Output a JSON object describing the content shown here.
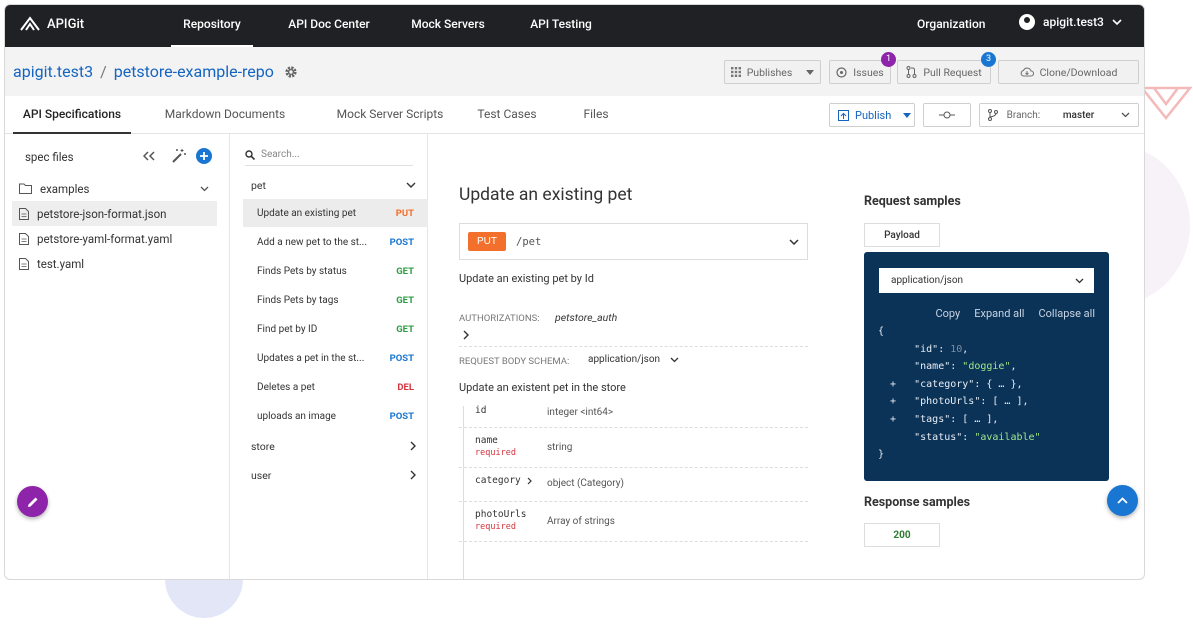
{
  "brand": {
    "name": "APIGit"
  },
  "nav": {
    "tabs": [
      "Repository",
      "API Doc Center",
      "Mock Servers",
      "API Testing"
    ],
    "organization": "Organization",
    "username": "apigit.test3"
  },
  "repo": {
    "owner": "apigit.test3",
    "separator": "/",
    "name": "petstore-example-repo",
    "publishes_label": "Publishes",
    "issues_label": "Issues",
    "issues_count": "1",
    "pull_request_label": "Pull Request",
    "pull_request_count": "3",
    "clone_label": "Clone/Download"
  },
  "subtabs": [
    "API Specifications",
    "Markdown Documents",
    "Mock Server Scripts",
    "Test Cases",
    "Files"
  ],
  "toolbar": {
    "publish_label": "Publish",
    "branch_label": "Branch:",
    "branch_value": "master"
  },
  "sidebar": {
    "title": "spec files",
    "folder": "examples",
    "files": [
      "petstore-json-format.json",
      "petstore-yaml-format.yaml",
      "test.yaml"
    ]
  },
  "operations": {
    "search_placeholder": "Search...",
    "groups": [
      "pet",
      "store",
      "user"
    ],
    "items": [
      {
        "label": "Update an existing pet",
        "method": "PUT"
      },
      {
        "label": "Add a new pet to the st...",
        "method": "POST"
      },
      {
        "label": "Finds Pets by status",
        "method": "GET"
      },
      {
        "label": "Finds Pets by tags",
        "method": "GET"
      },
      {
        "label": "Find pet by ID",
        "method": "GET"
      },
      {
        "label": "Updates a pet in the st...",
        "method": "POST"
      },
      {
        "label": "Deletes a pet",
        "method": "DEL"
      },
      {
        "label": "uploads an image",
        "method": "POST"
      }
    ]
  },
  "operation": {
    "title": "Update an existing pet",
    "method": "PUT",
    "path": "/pet",
    "description": "Update an existing pet by Id",
    "auth_label": "AUTHORIZATIONS:",
    "auth_value": "petstore_auth",
    "body_schema_label": "REQUEST BODY SCHEMA:",
    "body_schema_value": "application/json",
    "body_description": "Update an existent pet in the store",
    "fields": [
      {
        "name": "id",
        "required": "",
        "type": "integer <int64>"
      },
      {
        "name": "name",
        "required": "required",
        "type": "string"
      },
      {
        "name": "category",
        "required": "",
        "type": "object (Category)"
      },
      {
        "name": "photoUrls",
        "required": "required",
        "type": "Array of strings"
      }
    ]
  },
  "samples": {
    "request_title": "Request samples",
    "payload_tab": "Payload",
    "content_type": "application/json",
    "copy": "Copy",
    "expand_all": "Expand all",
    "collapse_all": "Collapse all",
    "response_title": "Response samples",
    "status_tab": "200"
  },
  "colors": {
    "put": "#f2702c",
    "post": "#1976d2",
    "get": "#2e9e44",
    "del": "#d4343e",
    "accent": "#8e24aa"
  }
}
